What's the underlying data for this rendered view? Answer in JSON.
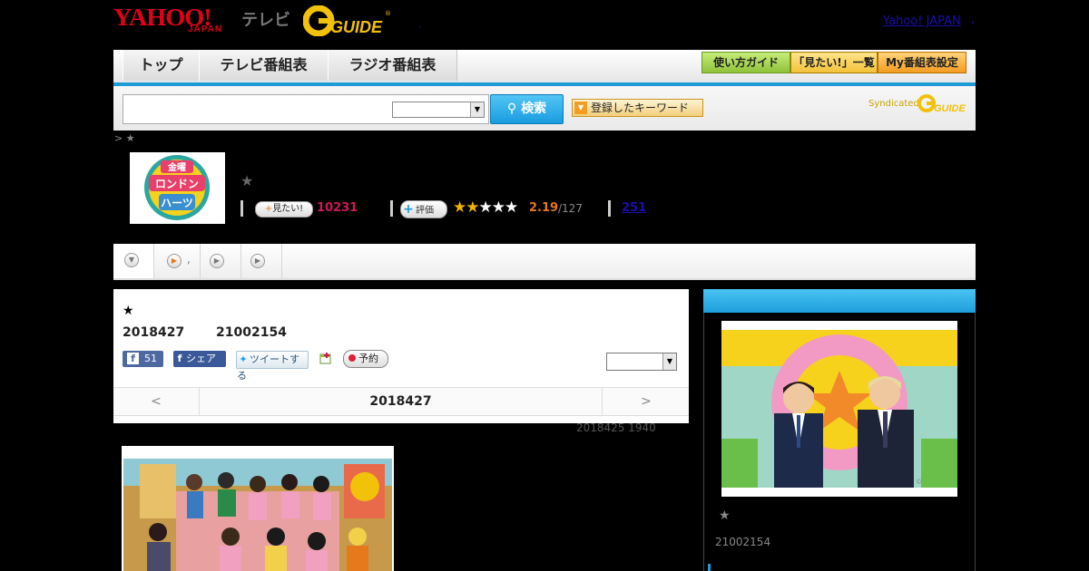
{
  "header": {
    "yahoo_logo": "YAHOO!",
    "yahoo_sub": "JAPAN",
    "tv_label": "テレビ",
    "gguide_logo": "G GUIDE",
    "yahoo_japan_link": "Yahoo! JAPAN",
    "link_sep": ",",
    "mid_sep": ","
  },
  "nav": {
    "tabs": [
      {
        "label": "トップ"
      },
      {
        "label": "テレビ番組表"
      },
      {
        "label": "ラジオ番組表"
      }
    ],
    "buttons": [
      {
        "label": "使い方ガイド",
        "color": "#9fd04a"
      },
      {
        "label": "「見たい!」一覧",
        "color": "#f7c948"
      },
      {
        "label": "My番組表設定",
        "color": "#f7a42a"
      }
    ]
  },
  "search": {
    "input_value": "",
    "select_value": "",
    "button_label": "検索",
    "keyword_button": "登録したキーワード",
    "syndicated": "Syndicated"
  },
  "breadcrumb": "> ★",
  "program": {
    "thumb_text": "☆金曜☆ ロンドン ハーツ",
    "star": "★",
    "want_label": "見たい!",
    "want_count": "10231",
    "rate_label": "評価",
    "rating": "2.19",
    "rating_count": "/127",
    "stars_filled": 2,
    "stars_total": 5,
    "comments": "251"
  },
  "subnav": {
    "tabs": [
      {
        "label": ""
      },
      {
        "label": ","
      },
      {
        "label": ""
      },
      {
        "label": ""
      }
    ]
  },
  "detail": {
    "star": "★",
    "date": "2018427",
    "time": "21002154",
    "fb_count": "51",
    "share_label": "シェア",
    "tweet_label": "ツイートする",
    "reserve_label": "予約",
    "select_value": "",
    "prev": "<",
    "current_date": "2018427",
    "next": ">",
    "updated": "2018425  1940"
  },
  "sidebar": {
    "star": "★",
    "time": "21002154"
  }
}
